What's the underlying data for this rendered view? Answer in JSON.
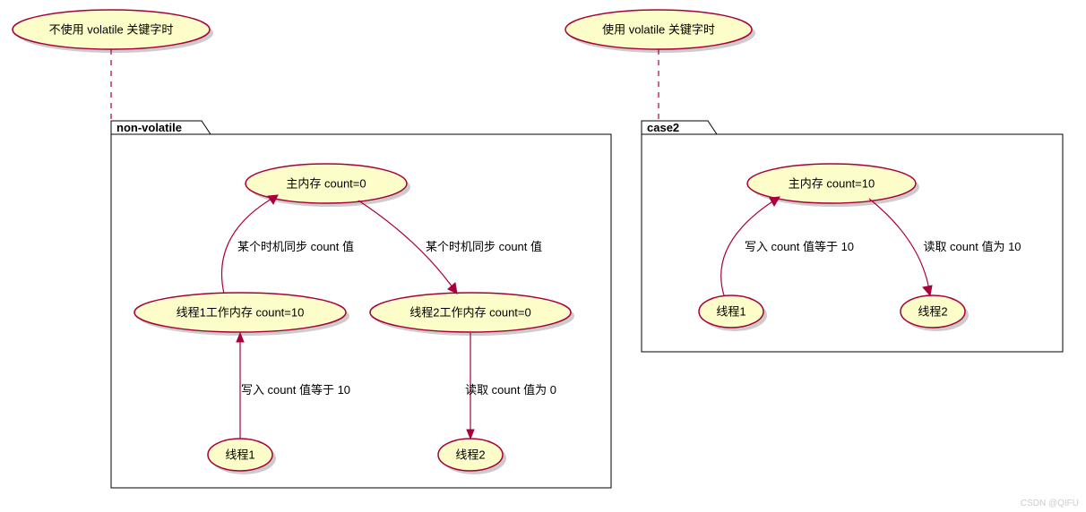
{
  "left": {
    "title": "不使用 volatile 关键字时",
    "tab": "non-volatile",
    "mainmem": "主内存 count=0",
    "thread1mem": "线程1工作内存 count=10",
    "thread2mem": "线程2工作内存 count=0",
    "thread1": "线程1",
    "thread2": "线程2",
    "edge_sync1": "某个时机同步 count 值",
    "edge_sync2": "某个时机同步 count 值",
    "edge_write": "写入 count 值等于 10",
    "edge_read": "读取 count 值为 0"
  },
  "right": {
    "title": "使用 volatile 关键字时",
    "tab": "case2",
    "mainmem": "主内存 count=10",
    "thread1": "线程1",
    "thread2": "线程2",
    "edge_write": "写入 count 值等于 10",
    "edge_read": "读取 count 值为 10"
  },
  "watermark": "CSDN @QIFU",
  "colors": {
    "fill": "#fdfdc9",
    "stroke": "#a8003c"
  }
}
